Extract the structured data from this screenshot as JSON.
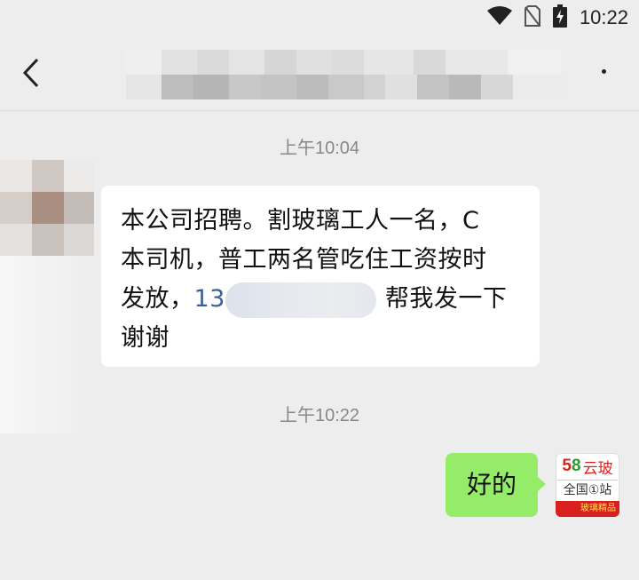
{
  "status_bar": {
    "time": "10:22",
    "icons": [
      "wifi-icon",
      "no-sim-icon",
      "battery-charging-icon"
    ]
  },
  "nav": {
    "back_icon": "chevron-left-icon",
    "title": "",
    "more_icon": "more-icon"
  },
  "messages": [
    {
      "timestamp": "上午10:04",
      "direction": "incoming",
      "lines": [
        "本公司招聘。割玻璃工人一名，C",
        "本司机，普工两名管吃住工资按时",
        "发放，",
        "谢谢"
      ],
      "phone_visible": "13",
      "after_phone": "帮我发一下"
    },
    {
      "timestamp": "上午10:22",
      "direction": "outgoing",
      "text": "好的"
    }
  ],
  "self_avatar": {
    "brand_num_5": "5",
    "brand_num_8": "8",
    "brand_name": "云玻",
    "slogan": "全国①站",
    "banner": "玻璃精品"
  },
  "colors": {
    "background": "#ededed",
    "incoming_bubble": "#ffffff",
    "outgoing_bubble": "#95ec69",
    "timestamp_text": "#888888",
    "phone_link": "#3a5f9a"
  }
}
